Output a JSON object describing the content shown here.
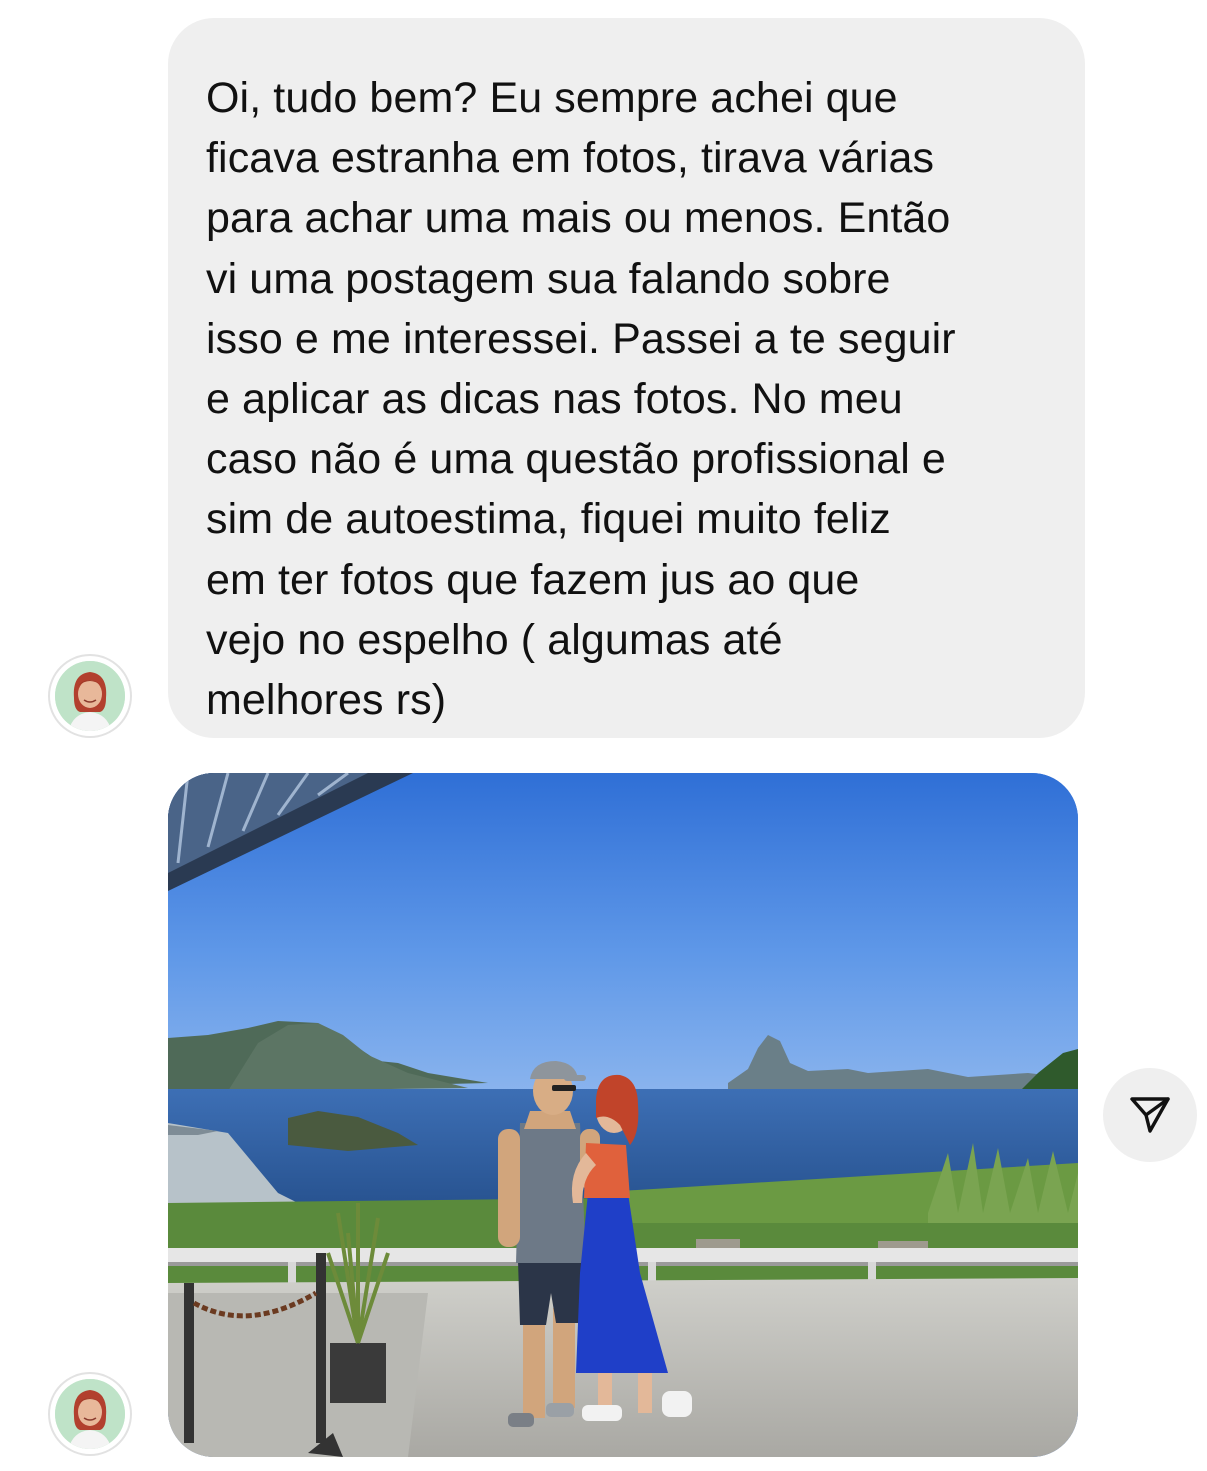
{
  "thread": {
    "messages": [
      {
        "type": "text",
        "sender": "incoming",
        "text": "Oi, tudo bem? Eu sempre achei que\nficava estranha em fotos, tirava várias\npara achar uma mais ou menos. Então\nvi uma postagem sua falando sobre\nisso e me interessei. Passei a te seguir\ne aplicar as dicas nas fotos. No meu\ncaso não é uma questão profissional e\nsim de autoestima, fiquei muito feliz\nem ter fotos que fazem jus ao que\nvejo no espelho ( algumas até\nmelhores rs)"
      },
      {
        "type": "image",
        "sender": "incoming",
        "image_description_icon": "couple-photo-seaside"
      }
    ]
  },
  "icons": {
    "avatar": "avatar-icon",
    "share": "send-paper-plane-icon"
  },
  "colors": {
    "bubble_bg": "#efefef",
    "text": "#111111",
    "sky": "#3b78d8"
  }
}
